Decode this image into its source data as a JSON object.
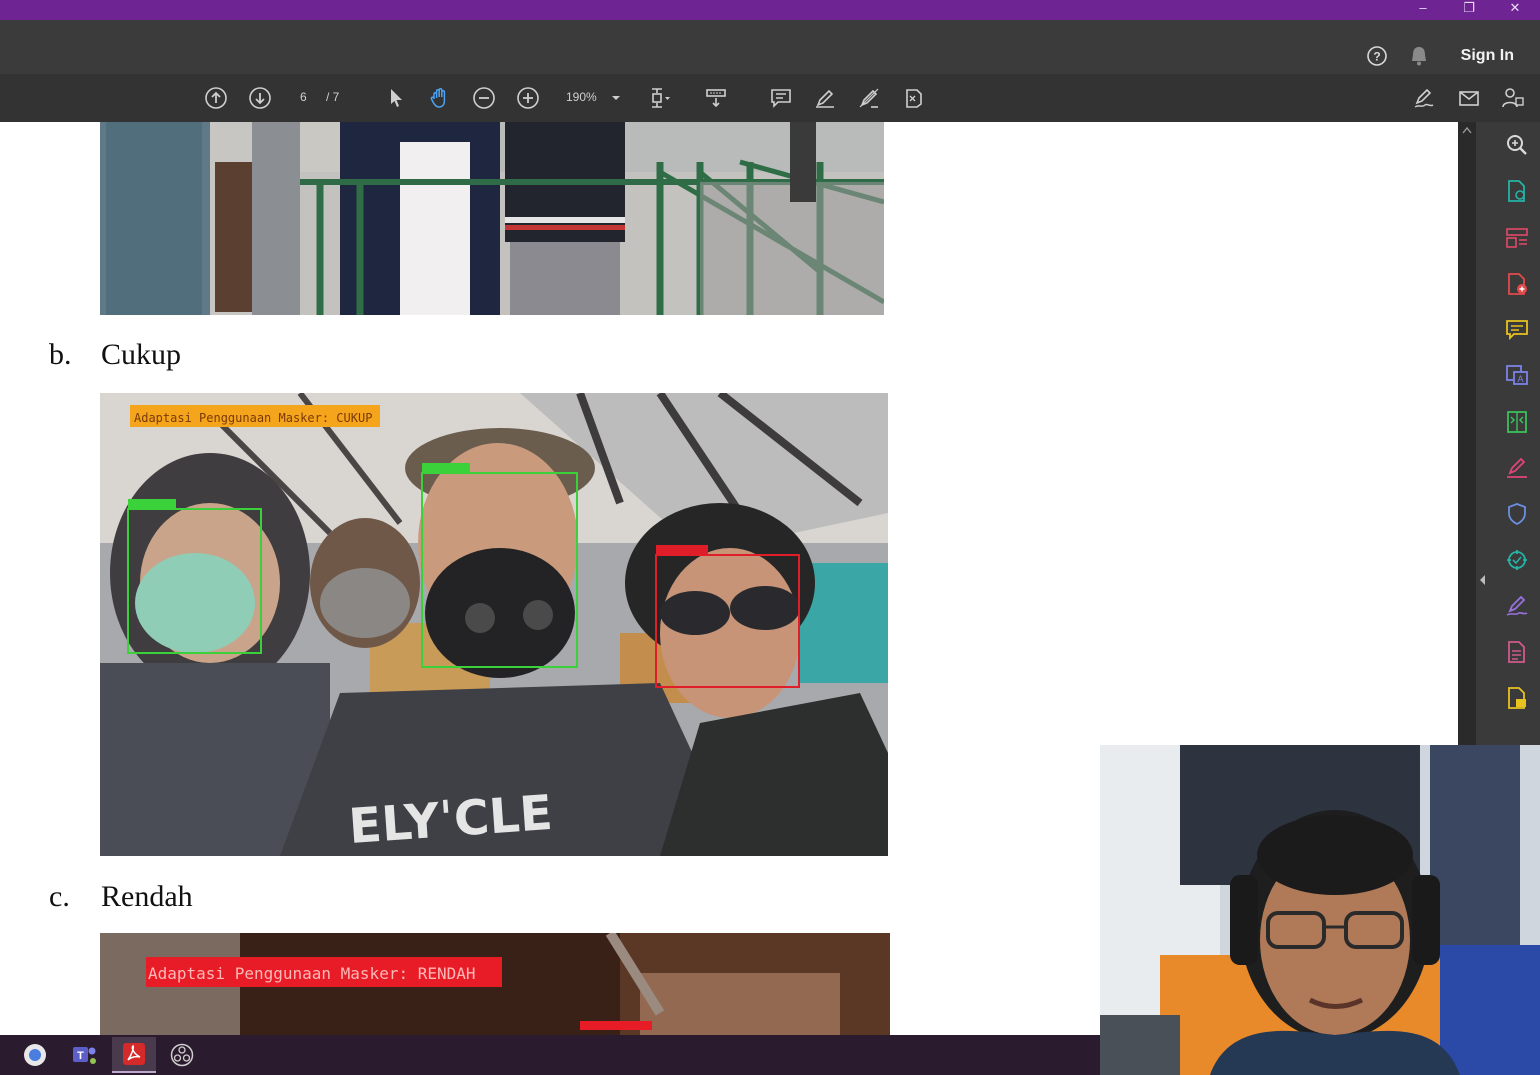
{
  "window": {
    "controls": {
      "minimize": "–",
      "restore": "❐",
      "close": "✕"
    }
  },
  "topbar": {
    "sign_in": "Sign In",
    "icons": [
      "help-icon",
      "bell-icon"
    ]
  },
  "toolbar": {
    "page_current": "6",
    "page_total": "/ 7",
    "zoom": "190%",
    "icons": [
      "page-up-icon",
      "page-down-icon",
      "select-cursor-icon",
      "hand-tool-icon",
      "zoom-out-icon",
      "zoom-in-icon",
      "zoom-dropdown-icon",
      "fit-page-icon",
      "scroll-mode-icon",
      "comment-icon",
      "highlight-pen-icon",
      "erase-pen-icon",
      "stamp-icon",
      "sign-icon",
      "email-icon",
      "account-icon"
    ]
  },
  "document": {
    "section_b": {
      "letter": "b.",
      "label": "Cukup"
    },
    "section_c": {
      "letter": "c.",
      "label": "Rendah"
    },
    "image_b": {
      "banner": "Adaptasi Penggunaan Masker: CUKUP",
      "boxes": [
        "Mask",
        "Mask",
        "No Mask"
      ]
    },
    "image_c": {
      "banner": "Adaptasi Penggunaan Masker: RENDAH"
    }
  },
  "right_panel": {
    "icons": [
      "search-icon",
      "export-pdf-icon",
      "organize-pages-icon",
      "create-pdf-icon",
      "comment-panel-icon",
      "translate-icon",
      "compress-icon",
      "fill-sign-icon",
      "protect-icon",
      "edit-pdf-icon",
      "request-signature-icon",
      "scan-icon",
      "more-tools-icon"
    ]
  },
  "taskbar": {
    "apps": [
      "chrome-icon",
      "teams-icon",
      "acrobat-icon",
      "obs-icon"
    ]
  },
  "colors": {
    "titlebar": "#6e2593",
    "topbar": "#3b3b3b",
    "toolbar": "#333333",
    "accent_blue": "#4ba3f5",
    "box_green": "#3bd13b",
    "box_red": "#e01e2a",
    "banner_orange": "#f5a51c",
    "banner_red": "#e81c26"
  }
}
